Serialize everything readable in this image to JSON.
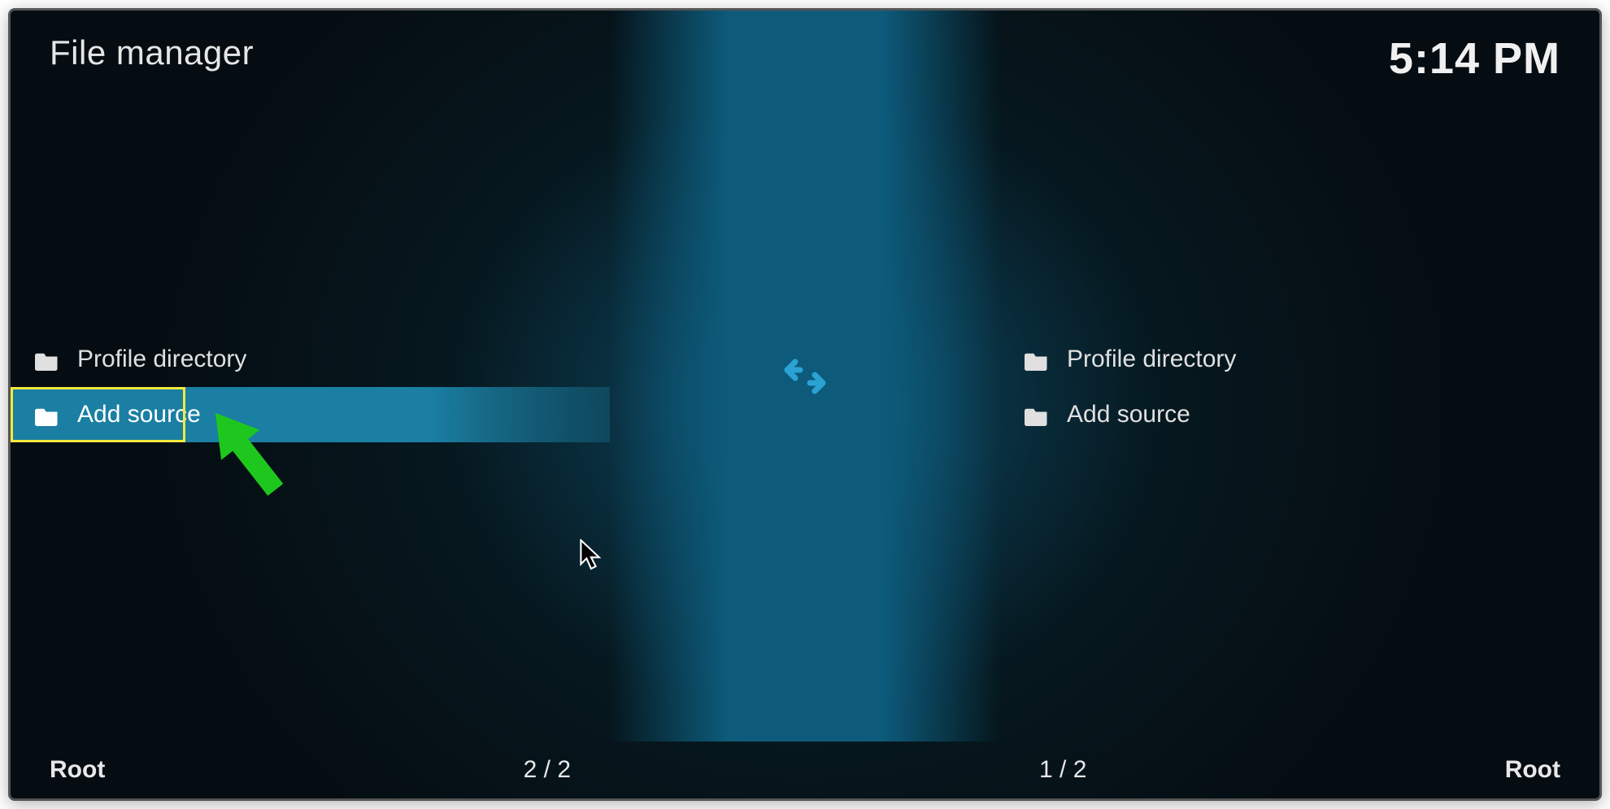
{
  "header": {
    "title": "File manager",
    "time": "5:14 PM"
  },
  "panes": {
    "left": {
      "items": [
        {
          "label": "Profile directory",
          "selected": false
        },
        {
          "label": "Add source",
          "selected": true
        }
      ],
      "footer_path": "Root",
      "footer_count": "2 / 2"
    },
    "right": {
      "items": [
        {
          "label": "Profile directory",
          "selected": false
        },
        {
          "label": "Add source",
          "selected": false
        }
      ],
      "footer_path": "Root",
      "footer_count": "1 / 2"
    }
  },
  "annotation": {
    "highlight_color": "#f5e83d",
    "arrow_color": "#1ec71e"
  }
}
